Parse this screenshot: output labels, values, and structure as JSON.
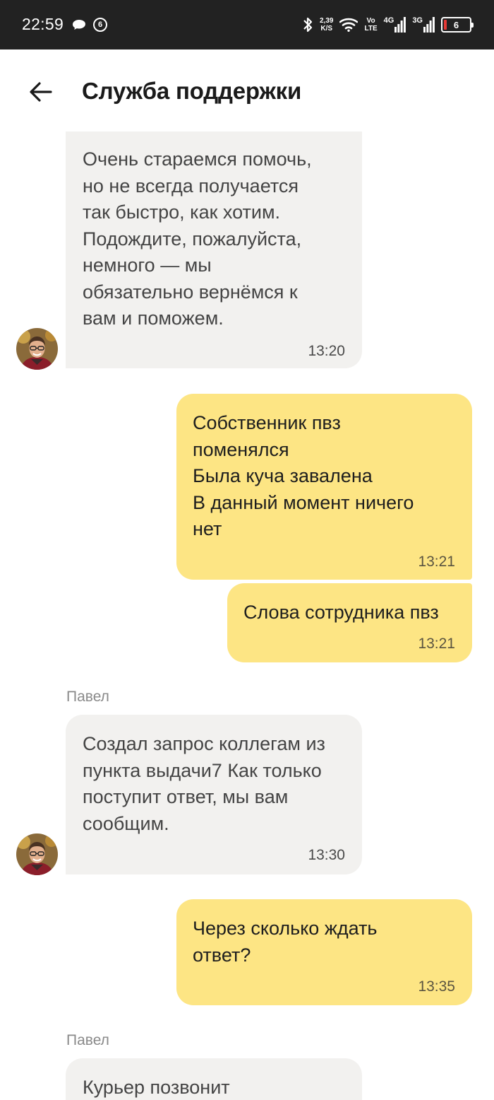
{
  "status_bar": {
    "time": "22:59",
    "notification_count": "6",
    "net_speed_value": "2,39",
    "net_speed_unit": "K/S",
    "volte_top": "Vo",
    "volte_bottom": "LTE",
    "signal1_label": "4G",
    "signal2_label": "3G",
    "battery_level": "6",
    "battery_color": "#e53935"
  },
  "header": {
    "title": "Служба поддержки"
  },
  "messages": [
    {
      "direction": "in",
      "text": "Очень стараемся помочь,\nно не всегда получается\nтак быстро, как хотим.\nПодождите, пожалуйста,\nнемного — мы\nобязательно вернёмся к\nвам и поможем.",
      "time": "13:20"
    },
    {
      "direction": "out",
      "text": "Собственник пвз\nпоменялся\nБыла куча завалена\nВ данный момент ничего\nнет",
      "time": "13:21"
    },
    {
      "direction": "out",
      "text": "Слова сотрудника пвз",
      "time": "13:21"
    },
    {
      "direction": "in",
      "sender": "Павел",
      "text": "Создал запрос коллегам из\nпункта выдачи7 Как только\nпоступит ответ, мы вам\nсообщим.",
      "time": "13:30"
    },
    {
      "direction": "out",
      "text": "Через сколько ждать\nответ?",
      "time": "13:35"
    },
    {
      "direction": "in",
      "sender": "Павел",
      "text": "Курьер позвонит",
      "time": ""
    }
  ],
  "colors": {
    "incoming_bubble": "#f2f1ef",
    "outgoing_bubble": "#fde584",
    "status_bar": "#222222"
  }
}
